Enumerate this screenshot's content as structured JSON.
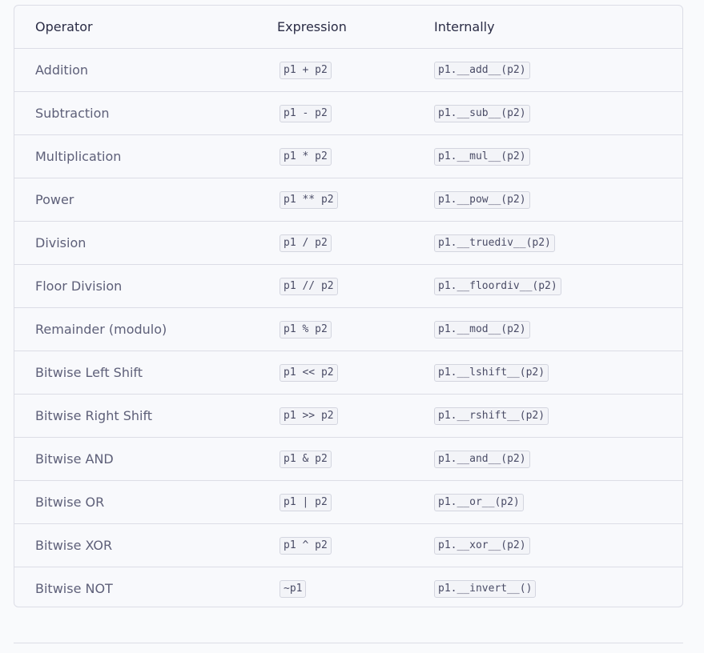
{
  "table": {
    "headers": {
      "operator": "Operator",
      "expression": "Expression",
      "internally": "Internally"
    },
    "rows": [
      {
        "operator": "Addition",
        "expression": "p1 + p2",
        "internally": "p1.__add__(p2)"
      },
      {
        "operator": "Subtraction",
        "expression": "p1 - p2",
        "internally": "p1.__sub__(p2)"
      },
      {
        "operator": "Multiplication",
        "expression": "p1 * p2",
        "internally": "p1.__mul__(p2)"
      },
      {
        "operator": "Power",
        "expression": "p1 ** p2",
        "internally": "p1.__pow__(p2)"
      },
      {
        "operator": "Division",
        "expression": "p1 / p2",
        "internally": "p1.__truediv__(p2)"
      },
      {
        "operator": "Floor Division",
        "expression": "p1 // p2",
        "internally": "p1.__floordiv__(p2)"
      },
      {
        "operator": "Remainder (modulo)",
        "expression": "p1 % p2",
        "internally": "p1.__mod__(p2)"
      },
      {
        "operator": "Bitwise Left Shift",
        "expression": "p1 << p2",
        "internally": "p1.__lshift__(p2)"
      },
      {
        "operator": "Bitwise Right Shift",
        "expression": "p1 >> p2",
        "internally": "p1.__rshift__(p2)"
      },
      {
        "operator": "Bitwise AND",
        "expression": "p1 & p2",
        "internally": "p1.__and__(p2)"
      },
      {
        "operator": "Bitwise OR",
        "expression": "p1 | p2",
        "internally": "p1.__or__(p2)"
      },
      {
        "operator": "Bitwise XOR",
        "expression": "p1 ^ p2",
        "internally": "p1.__xor__(p2)"
      },
      {
        "operator": "Bitwise NOT",
        "expression": "~p1",
        "internally": "p1.__invert__()"
      }
    ]
  },
  "colors": {
    "background": "#f9fafc",
    "border": "#dcdde6",
    "header_text": "#2a2c45",
    "body_text": "#5e6079"
  }
}
